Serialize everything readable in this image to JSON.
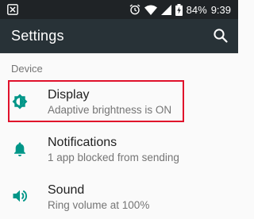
{
  "status_bar": {
    "battery_percent": "84%",
    "time": "9:39",
    "icons": [
      "notification-x-icon",
      "alarm-icon",
      "wifi-icon",
      "cellular-signal-icon",
      "battery-charging-icon"
    ]
  },
  "app_bar": {
    "title": "Settings",
    "search_icon": "search-icon"
  },
  "section": {
    "header": "Device"
  },
  "items": [
    {
      "title": "Display",
      "subtitle": "Adaptive brightness is ON",
      "icon": "brightness-icon"
    },
    {
      "title": "Notifications",
      "subtitle": "1 app blocked from sending",
      "icon": "bell-icon"
    },
    {
      "title": "Sound",
      "subtitle": "Ring volume at 100%",
      "icon": "volume-icon"
    }
  ],
  "colors": {
    "status_bar": "#1f2326",
    "app_bar": "#283237",
    "accent_teal": "#009688",
    "highlight_red": "#e0112b"
  }
}
